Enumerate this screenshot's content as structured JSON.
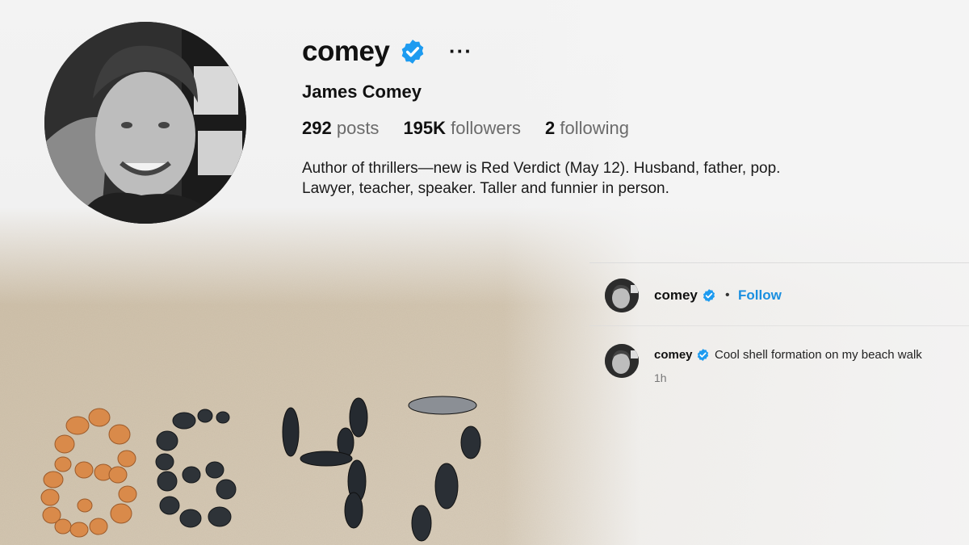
{
  "profile": {
    "username": "comey",
    "display_name": "James Comey",
    "more_label": "···",
    "stats": [
      {
        "count": "292",
        "label": "posts"
      },
      {
        "count": "195K",
        "label": "followers"
      },
      {
        "count": "2",
        "label": "following"
      }
    ],
    "bio": "Author of thrillers—new is Red Verdict (May 12). Husband, father, pop. Lawyer, teacher, speaker. Taller and funnier in person."
  },
  "post": {
    "author": "comey",
    "separator": "•",
    "follow_label": "Follow",
    "comment_author": "comey",
    "caption": "Cool shell formation on my beach walk",
    "time": "1h"
  },
  "colors": {
    "verified": "#1d9bf0",
    "follow": "#1a8fe0",
    "sand": "#cdbfa9"
  },
  "icons": [
    "verified-badge-icon",
    "more-options-icon"
  ]
}
